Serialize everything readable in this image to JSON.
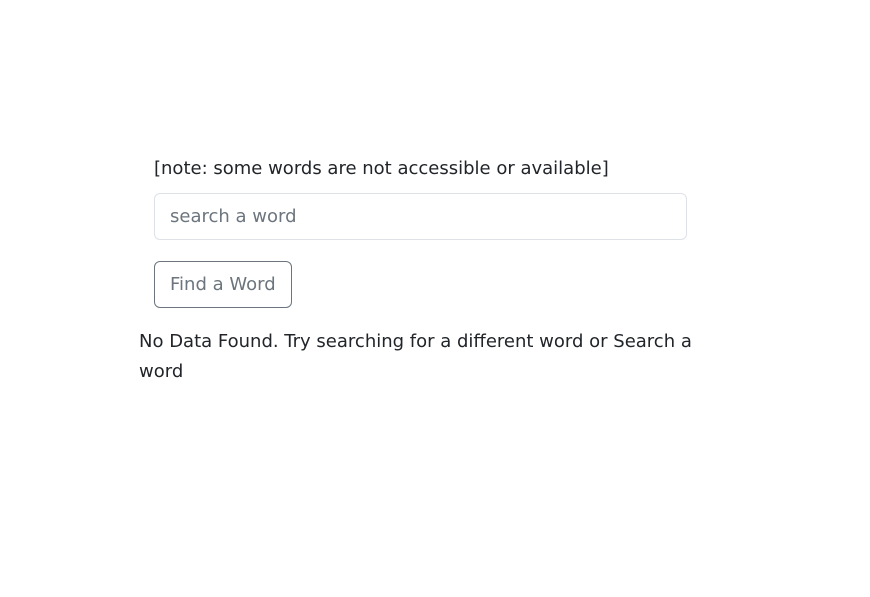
{
  "search": {
    "note": "[note: some words are not accessible or available]",
    "placeholder": "search a word",
    "value": "",
    "button_label": "Find a Word"
  },
  "result": {
    "message": "No Data Found. Try searching for a different word or Search a word"
  }
}
